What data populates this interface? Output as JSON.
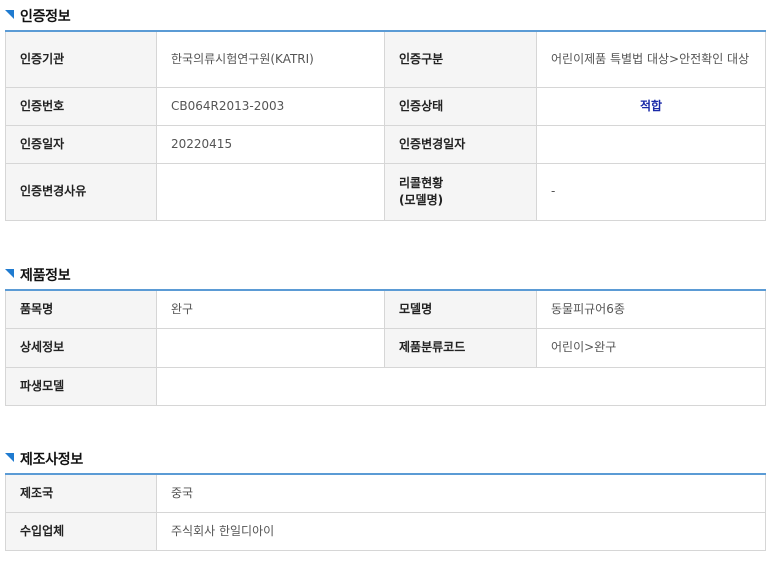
{
  "cert": {
    "title": "인증정보",
    "agency_label": "인증기관",
    "agency_value": "한국의류시험연구원(KATRI)",
    "type_label": "인증구분",
    "type_value": "어린이제품 특별법 대상>안전확인 대상",
    "number_label": "인증번호",
    "number_value": "CB064R2013-2003",
    "status_label": "인증상태",
    "status_value": "적합",
    "date_label": "인증일자",
    "date_value": "20220415",
    "change_date_label": "인증변경일자",
    "change_date_value": "",
    "change_reason_label": "인증변경사유",
    "change_reason_value": "",
    "recall_label_1": "리콜현황",
    "recall_label_2": "(모델명)",
    "recall_value": "-"
  },
  "product": {
    "title": "제품정보",
    "item_label": "품목명",
    "item_value": "완구",
    "model_label": "모델명",
    "model_value": "동물피규어6종",
    "detail_label": "상세정보",
    "detail_value": "",
    "class_code_label": "제품분류코드",
    "class_code_value": "어린이>완구",
    "derived_label": "파생모델",
    "derived_value": ""
  },
  "maker": {
    "title": "제조사정보",
    "country_label": "제조국",
    "country_value": "중국",
    "importer_label": "수입업체",
    "importer_value": "주식회사 한일디아이"
  },
  "colors": {
    "accent": "#1f7bd0",
    "table_top_border": "#5b9bd5",
    "status_ok": "#1a2aa8",
    "label_bg": "#f5f5f5"
  }
}
